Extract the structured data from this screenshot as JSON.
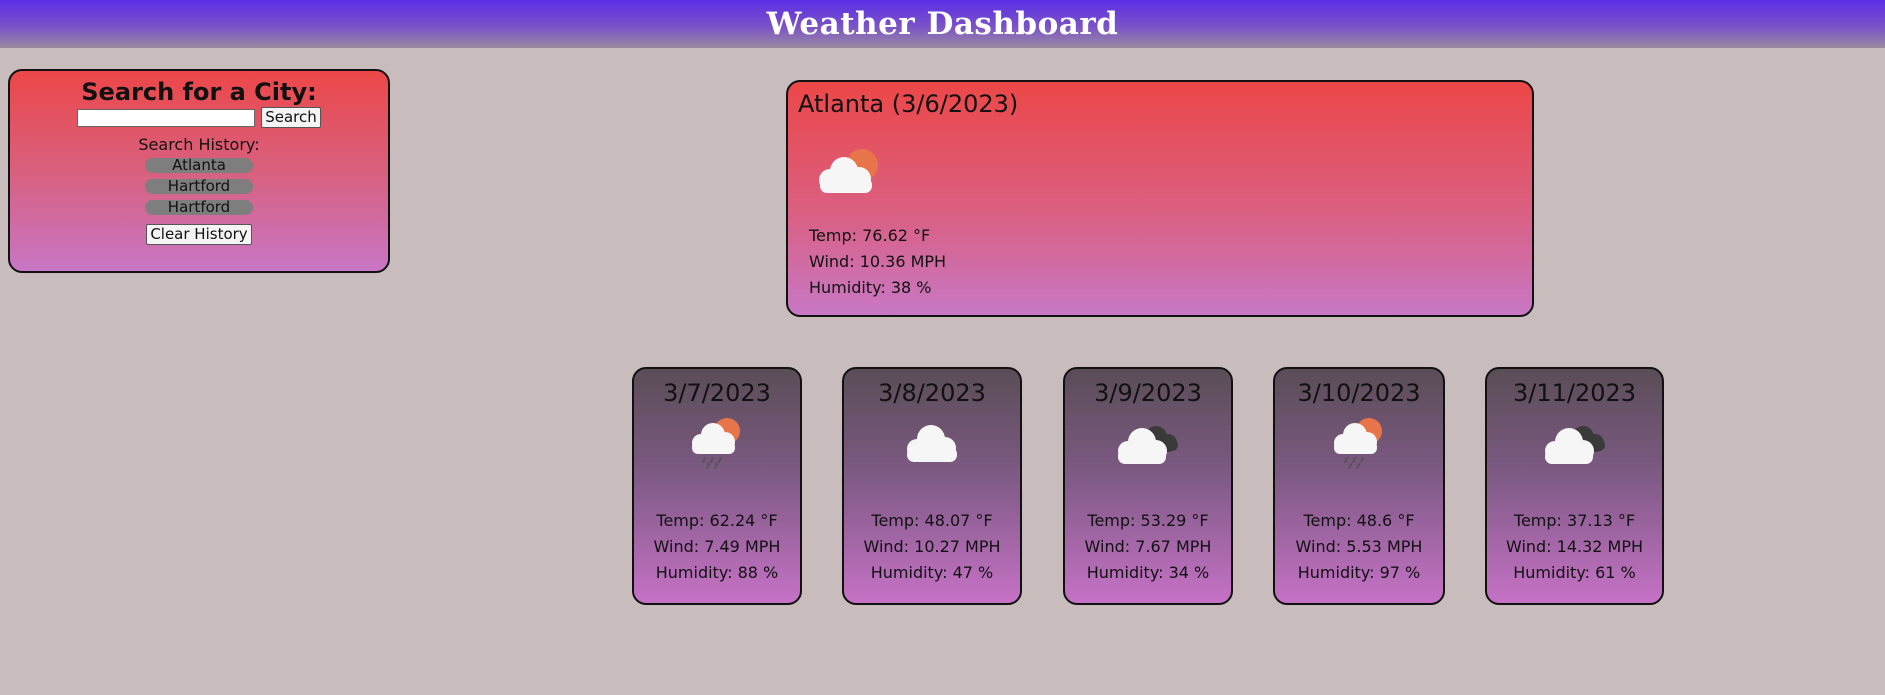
{
  "header": {
    "title": "Weather Dashboard"
  },
  "search": {
    "title": "Search for a City:",
    "input_value": "",
    "button_label": "Search",
    "history_title": "Search History:",
    "history": [
      "Atlanta",
      "Hartford",
      "Hartford"
    ],
    "clear_label": "Clear History"
  },
  "current": {
    "title": "Atlanta (3/6/2023)",
    "icon": "partly-cloudy-day-icon",
    "temp": "Temp: 76.62 °F",
    "wind": "Wind: 10.36 MPH",
    "humidity": "Humidity: 38 %"
  },
  "forecast": [
    {
      "date": "3/7/2023",
      "icon": "rain-sun-icon",
      "temp": "Temp: 62.24 °F",
      "wind": "Wind: 7.49 MPH",
      "humidity": "Humidity: 88 %"
    },
    {
      "date": "3/8/2023",
      "icon": "cloud-icon",
      "temp": "Temp: 48.07 °F",
      "wind": "Wind: 10.27 MPH",
      "humidity": "Humidity: 47 %"
    },
    {
      "date": "3/9/2023",
      "icon": "broken-clouds-icon",
      "temp": "Temp: 53.29 °F",
      "wind": "Wind: 7.67 MPH",
      "humidity": "Humidity: 34 %"
    },
    {
      "date": "3/10/2023",
      "icon": "rain-sun-icon",
      "temp": "Temp: 48.6 °F",
      "wind": "Wind: 5.53 MPH",
      "humidity": "Humidity: 97 %"
    },
    {
      "date": "3/11/2023",
      "icon": "broken-clouds-icon",
      "temp": "Temp: 37.13 °F",
      "wind": "Wind: 14.32 MPH",
      "humidity": "Humidity: 61 %"
    }
  ]
}
